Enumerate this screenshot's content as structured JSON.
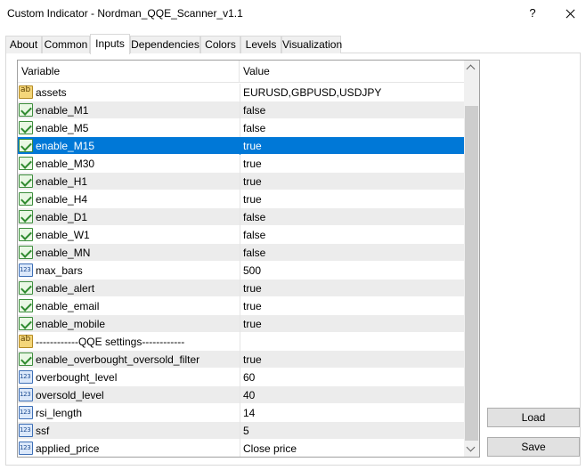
{
  "window": {
    "title": "Custom Indicator - Nordman_QQE_Scanner_v1.1",
    "help_label": "?"
  },
  "tabs": [
    {
      "label": "About"
    },
    {
      "label": "Common"
    },
    {
      "label": "Inputs",
      "active": true
    },
    {
      "label": "Dependencies"
    },
    {
      "label": "Colors"
    },
    {
      "label": "Levels"
    },
    {
      "label": "Visualization"
    }
  ],
  "grid": {
    "headers": {
      "variable": "Variable",
      "value": "Value"
    },
    "rows": [
      {
        "icon": "text-type-icon",
        "variable": "assets",
        "value": "EURUSD,GBPUSD,USDJPY"
      },
      {
        "icon": "bool-type-icon",
        "variable": "enable_M1",
        "value": "false"
      },
      {
        "icon": "bool-type-icon",
        "variable": "enable_M5",
        "value": "false"
      },
      {
        "icon": "bool-type-icon",
        "variable": "enable_M15",
        "value": "true",
        "selected": true
      },
      {
        "icon": "bool-type-icon",
        "variable": "enable_M30",
        "value": "true"
      },
      {
        "icon": "bool-type-icon",
        "variable": "enable_H1",
        "value": "true"
      },
      {
        "icon": "bool-type-icon",
        "variable": "enable_H4",
        "value": "true"
      },
      {
        "icon": "bool-type-icon",
        "variable": "enable_D1",
        "value": "false"
      },
      {
        "icon": "bool-type-icon",
        "variable": "enable_W1",
        "value": "false"
      },
      {
        "icon": "bool-type-icon",
        "variable": "enable_MN",
        "value": "false"
      },
      {
        "icon": "number-type-icon",
        "variable": "max_bars",
        "value": "500"
      },
      {
        "icon": "bool-type-icon",
        "variable": "enable_alert",
        "value": "true"
      },
      {
        "icon": "bool-type-icon",
        "variable": "enable_email",
        "value": "true"
      },
      {
        "icon": "bool-type-icon",
        "variable": "enable_mobile",
        "value": "true"
      },
      {
        "icon": "text-type-icon",
        "variable": "------------QQE settings------------",
        "value": ""
      },
      {
        "icon": "bool-type-icon",
        "variable": "enable_overbought_oversold_filter",
        "value": "true"
      },
      {
        "icon": "number-type-icon",
        "variable": "overbought_level",
        "value": "60"
      },
      {
        "icon": "number-type-icon",
        "variable": "oversold_level",
        "value": "40"
      },
      {
        "icon": "number-type-icon",
        "variable": "rsi_length",
        "value": "14"
      },
      {
        "icon": "number-type-icon",
        "variable": "ssf",
        "value": "5"
      },
      {
        "icon": "number-type-icon",
        "variable": "applied_price",
        "value": "Close price"
      }
    ]
  },
  "buttons": {
    "load": "Load",
    "save": "Save"
  },
  "colors": {
    "selection": "#0078d7",
    "alt_row": "#ececec"
  }
}
